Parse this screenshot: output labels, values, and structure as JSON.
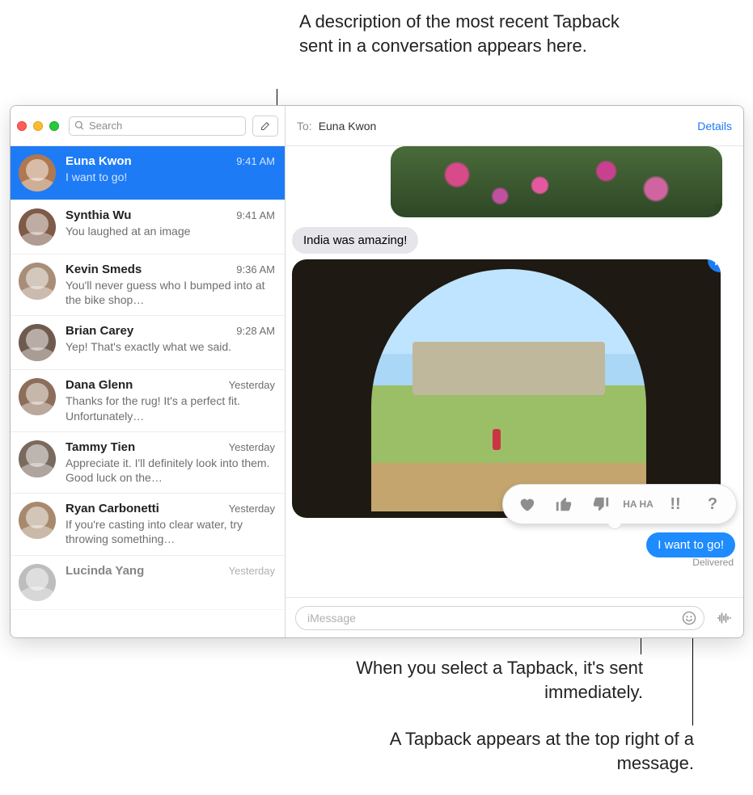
{
  "callouts": {
    "top": "A description of the most recent Tapback sent in a conversation appears here.",
    "mid": "When you select a Tapback, it's sent immediately.",
    "bot": "A Tapback appears at the top right of a message."
  },
  "search": {
    "placeholder": "Search"
  },
  "conversations": [
    {
      "name": "Euna Kwon",
      "time": "9:41 AM",
      "snippet": "I want to go!",
      "sel": true
    },
    {
      "name": "Synthia Wu",
      "time": "9:41 AM",
      "snippet": "You laughed at an image"
    },
    {
      "name": "Kevin Smeds",
      "time": "9:36 AM",
      "snippet": "You'll never guess who I bumped into at the bike shop…"
    },
    {
      "name": "Brian Carey",
      "time": "9:28 AM",
      "snippet": "Yep! That's exactly what we said."
    },
    {
      "name": "Dana Glenn",
      "time": "Yesterday",
      "snippet": "Thanks for the rug! It's a perfect fit. Unfortunately…"
    },
    {
      "name": "Tammy Tien",
      "time": "Yesterday",
      "snippet": "Appreciate it. I'll definitely look into them. Good luck on the…"
    },
    {
      "name": "Ryan Carbonetti",
      "time": "Yesterday",
      "snippet": "If you're casting into clear water, try throwing something…"
    },
    {
      "name": "Lucinda Yang",
      "time": "Yesterday",
      "snippet": ""
    }
  ],
  "header": {
    "to_label": "To:",
    "recipient": "Euna Kwon",
    "details": "Details"
  },
  "messages": {
    "incoming_text": "India was amazing!",
    "outgoing_text": "I want to go!",
    "delivered": "Delivered"
  },
  "tapback_options": {
    "heart": "heart",
    "like": "like",
    "dislike": "dislike",
    "haha": "HA HA",
    "emphasize": "!!",
    "question": "?"
  },
  "input": {
    "placeholder": "iMessage"
  }
}
